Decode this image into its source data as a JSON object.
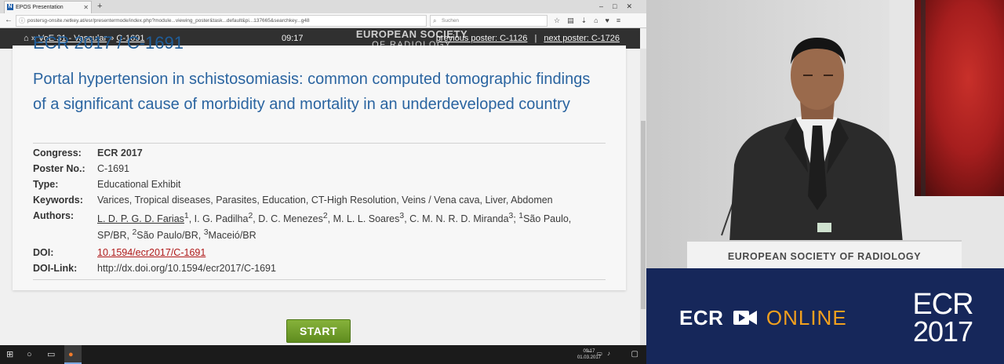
{
  "browser": {
    "tab_title": "EPOS Presentation",
    "url": "postersg-onsite.netkey.at/esr/presentermode/index.php?module...viewing_poster&task...default&pi...137665&searchkey...g48",
    "search_placeholder": "Suchen"
  },
  "appbar": {
    "crumb1": "VoE 31 - Vascular",
    "crumb2": "C-1691",
    "timer": "09:17",
    "logo_line1": "EUROPEAN SOCIETY",
    "logo_line2": "OF RADIOLOGY",
    "previous": "previous poster: C-1126",
    "separator": "|",
    "next": "next poster: C-1726"
  },
  "poster": {
    "cut_heading": "ECR 2017 / C-1691",
    "title": "Portal hypertension in schistosomiasis: common computed tomographic findings of a significant cause of morbidity and mortality in an underdeveloped country",
    "congress_label": "Congress:",
    "congress": "ECR 2017",
    "posterno_label": "Poster No.:",
    "posterno": "C-1691",
    "type_label": "Type:",
    "type": "Educational Exhibit",
    "keywords_label": "Keywords:",
    "keywords": "Varices, Tropical diseases, Parasites, Education, CT-High Resolution, Veins / Vena cava, Liver, Abdomen",
    "authors_label": "Authors:",
    "author1": "L. D. P. G. D. Farias",
    "authors_rest1": ", I. G. Padilha",
    "authors_rest2": ", D. C. Menezes",
    "authors_rest3": ", M. L. L. Soares",
    "authors_rest4": ", C. M. N. R. D. Miranda",
    "affil1": "São",
    "affil1b": "Paulo, SP/BR, ",
    "affil2": "São Paulo/BR, ",
    "affil3": "Maceió/BR",
    "doi_label": "DOI:",
    "doi": "10.1594/ecr2017/C-1691",
    "doilink_label": "DOI-Link:",
    "doilink": "http://dx.doi.org/10.1594/ecr2017/C-1691"
  },
  "start_button": "START",
  "taskbar": {
    "clock_time": "09:17",
    "clock_date": "01.03.2017"
  },
  "speaker": {
    "podium_text": "EUROPEAN SOCIETY OF RADIOLOGY"
  },
  "brand": {
    "ecr": "ECR",
    "online": "ONLINE",
    "year_line1": "ECR",
    "year_line2": "2017"
  },
  "colors": {
    "title_blue": "#2a64a0",
    "start_green": "#6f9e2a",
    "doi_red": "#b01a1a",
    "brand_navy": "#16275a",
    "brand_orange": "#f2a01e"
  }
}
